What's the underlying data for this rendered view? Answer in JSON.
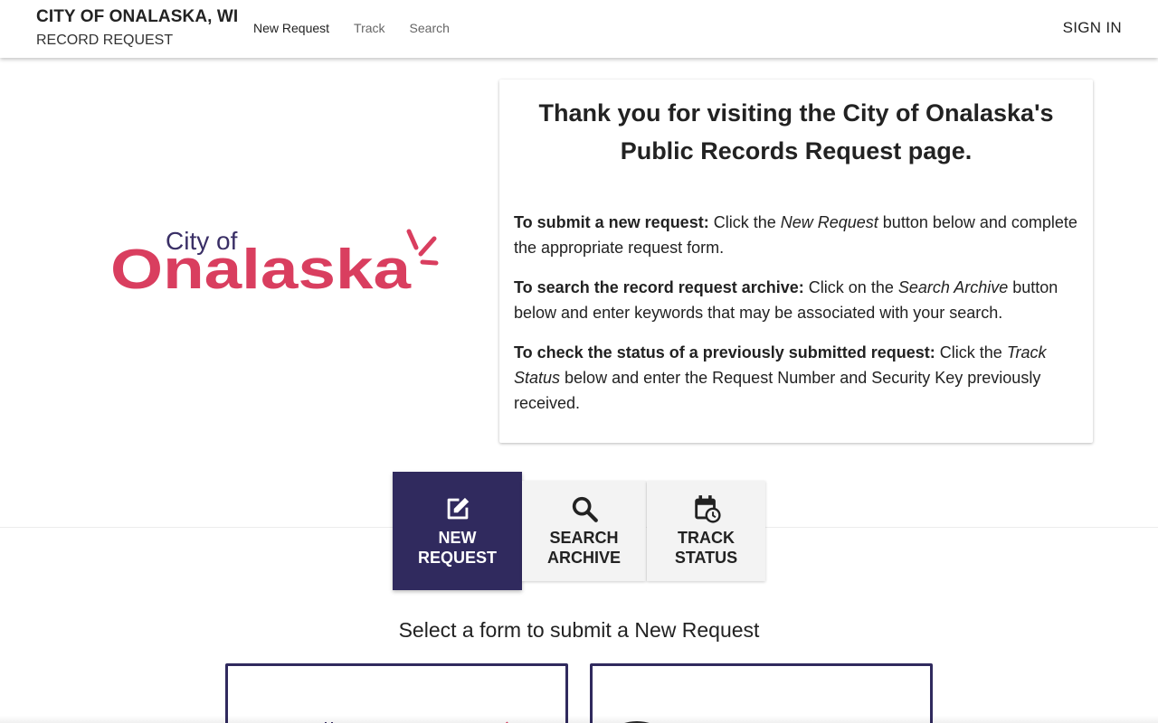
{
  "header": {
    "org_name": "CITY OF ONALASKA, WI",
    "app_name": "RECORD REQUEST",
    "nav": [
      {
        "label": "New Request"
      },
      {
        "label": "Track"
      },
      {
        "label": "Search"
      }
    ],
    "sign_in": "SIGN IN"
  },
  "logo": {
    "top_text": "City of",
    "main_text": "Onalaska",
    "color": "#d93e5f",
    "top_color": "#3a2f66"
  },
  "info": {
    "heading": "Thank you for visiting the City of Onalaska's Public Records Request page.",
    "para1": {
      "bold": "To submit a new request:",
      "pre": " Click the ",
      "italic": "New Request",
      "post": " button below and complete the appropriate request form."
    },
    "para2": {
      "bold": "To search the record request archive:",
      "pre": " Click on the ",
      "italic": "Search Archive",
      "post": " button below and enter keywords that may be associated with your search."
    },
    "para3": {
      "bold": "To check the status of a previously submitted request:",
      "pre": " Click the ",
      "italic": "Track Status",
      "post": " below and enter the Request Number and Security Key previously received."
    }
  },
  "actions": {
    "new_request": {
      "line1": "NEW",
      "line2": "REQUEST",
      "icon": "edit-icon"
    },
    "search_archive": {
      "line1": "SEARCH",
      "line2": "ARCHIVE",
      "icon": "search-icon"
    },
    "track_status": {
      "line1": "TRACK",
      "line2": "STATUS",
      "icon": "calendar-clock-icon"
    }
  },
  "select_heading": "Select a form to submit a New Request",
  "colors": {
    "primary": "#302a5e",
    "accent": "#d93e5f"
  }
}
